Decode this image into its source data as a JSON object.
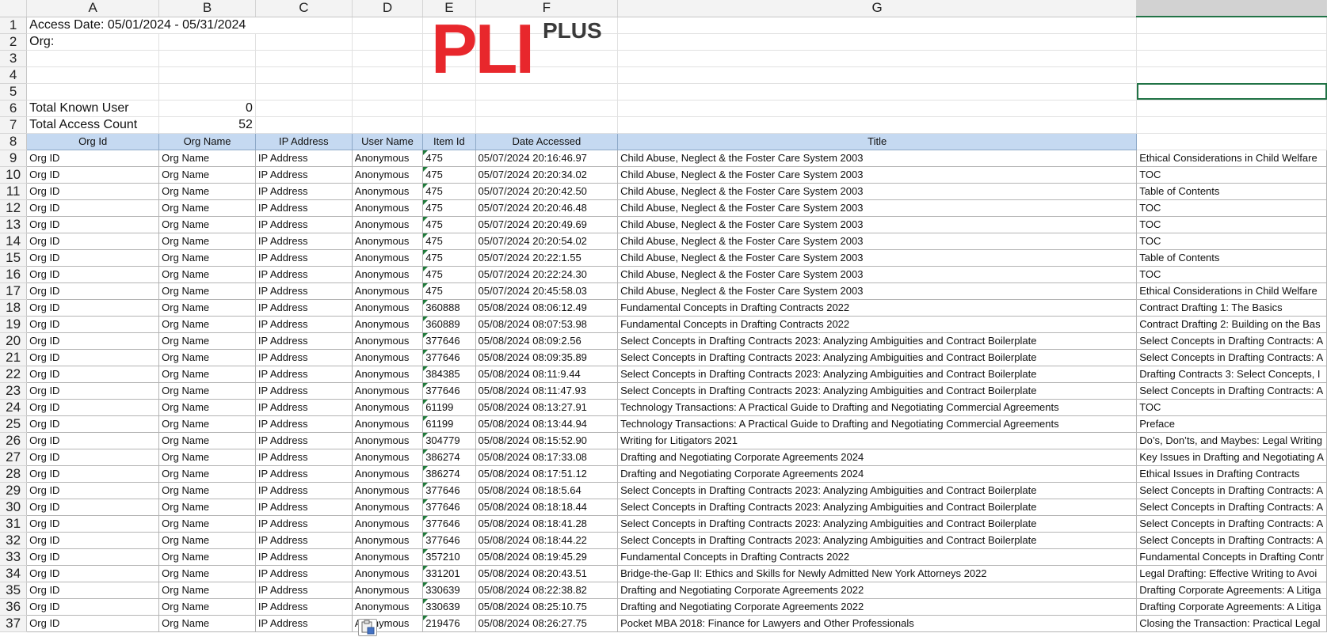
{
  "columns": [
    "A",
    "B",
    "C",
    "D",
    "E",
    "F",
    "G"
  ],
  "info": {
    "access_date": "Access Date:  05/01/2024 - 05/31/2024",
    "org": "Org:",
    "known_user_label": "Total Known User",
    "known_user_value": "0",
    "access_count_label": "Total Access Count",
    "access_count_value": "52"
  },
  "logo": {
    "main": "PLI",
    "sub": "PLUS",
    "color": "#e8272c"
  },
  "headers": [
    "Org Id",
    "Org Name",
    "IP Address",
    "User Name",
    "Item Id",
    "Date Accessed",
    "Title"
  ],
  "rows": [
    {
      "n": "9",
      "org_id": "Org ID",
      "org_name": "Org Name",
      "ip": "IP Address",
      "user": "Anonymous",
      "item": "475",
      "date": "05/07/2024 20:16:46.97",
      "title": "Child Abuse, Neglect & the Foster Care System 2003",
      "extra": "Ethical Considerations in Child Welfare"
    },
    {
      "n": "10",
      "org_id": "Org ID",
      "org_name": "Org Name",
      "ip": "IP Address",
      "user": "Anonymous",
      "item": "475",
      "date": "05/07/2024 20:20:34.02",
      "title": "Child Abuse, Neglect & the Foster Care System 2003",
      "extra": "TOC"
    },
    {
      "n": "11",
      "org_id": "Org ID",
      "org_name": "Org Name",
      "ip": "IP Address",
      "user": "Anonymous",
      "item": "475",
      "date": "05/07/2024 20:20:42.50",
      "title": "Child Abuse, Neglect & the Foster Care System 2003",
      "extra": "Table of Contents"
    },
    {
      "n": "12",
      "org_id": "Org ID",
      "org_name": "Org Name",
      "ip": "IP Address",
      "user": "Anonymous",
      "item": "475",
      "date": "05/07/2024 20:20:46.48",
      "title": "Child Abuse, Neglect & the Foster Care System 2003",
      "extra": "TOC"
    },
    {
      "n": "13",
      "org_id": "Org ID",
      "org_name": "Org Name",
      "ip": "IP Address",
      "user": "Anonymous",
      "item": "475",
      "date": "05/07/2024 20:20:49.69",
      "title": "Child Abuse, Neglect & the Foster Care System 2003",
      "extra": "TOC"
    },
    {
      "n": "14",
      "org_id": "Org ID",
      "org_name": "Org Name",
      "ip": "IP Address",
      "user": "Anonymous",
      "item": "475",
      "date": "05/07/2024 20:20:54.02",
      "title": "Child Abuse, Neglect & the Foster Care System 2003",
      "extra": "TOC"
    },
    {
      "n": "15",
      "org_id": "Org ID",
      "org_name": "Org Name",
      "ip": "IP Address",
      "user": "Anonymous",
      "item": "475",
      "date": "05/07/2024 20:22:1.55",
      "title": "Child Abuse, Neglect & the Foster Care System 2003",
      "extra": "Table of Contents"
    },
    {
      "n": "16",
      "org_id": "Org ID",
      "org_name": "Org Name",
      "ip": "IP Address",
      "user": "Anonymous",
      "item": "475",
      "date": "05/07/2024 20:22:24.30",
      "title": "Child Abuse, Neglect & the Foster Care System 2003",
      "extra": "TOC"
    },
    {
      "n": "17",
      "org_id": "Org ID",
      "org_name": "Org Name",
      "ip": "IP Address",
      "user": "Anonymous",
      "item": "475",
      "date": "05/07/2024 20:45:58.03",
      "title": "Child Abuse, Neglect & the Foster Care System 2003",
      "extra": "Ethical Considerations in Child Welfare"
    },
    {
      "n": "18",
      "org_id": "Org ID",
      "org_name": "Org Name",
      "ip": "IP Address",
      "user": "Anonymous",
      "item": "360888",
      "date": "05/08/2024 08:06:12.49",
      "title": "Fundamental Concepts in Drafting Contracts 2022",
      "extra": "Contract Drafting 1: The Basics"
    },
    {
      "n": "19",
      "org_id": "Org ID",
      "org_name": "Org Name",
      "ip": "IP Address",
      "user": "Anonymous",
      "item": "360889",
      "date": "05/08/2024 08:07:53.98",
      "title": "Fundamental Concepts in Drafting Contracts 2022",
      "extra": "Contract Drafting 2: Building on the Bas"
    },
    {
      "n": "20",
      "org_id": "Org ID",
      "org_name": "Org Name",
      "ip": "IP Address",
      "user": "Anonymous",
      "item": "377646",
      "date": "05/08/2024 08:09:2.56",
      "title": "Select Concepts in Drafting Contracts 2023: Analyzing Ambiguities and Contract Boilerplate",
      "extra": "Select Concepts in Drafting Contracts: A"
    },
    {
      "n": "21",
      "org_id": "Org ID",
      "org_name": "Org Name",
      "ip": "IP Address",
      "user": "Anonymous",
      "item": "377646",
      "date": "05/08/2024 08:09:35.89",
      "title": "Select Concepts in Drafting Contracts 2023: Analyzing Ambiguities and Contract Boilerplate",
      "extra": "Select Concepts in Drafting Contracts: A"
    },
    {
      "n": "22",
      "org_id": "Org ID",
      "org_name": "Org Name",
      "ip": "IP Address",
      "user": "Anonymous",
      "item": "384385",
      "date": "05/08/2024 08:11:9.44",
      "title": "Select Concepts in Drafting Contracts 2023: Analyzing Ambiguities and Contract Boilerplate",
      "extra": "Drafting Contracts 3: Select Concepts, I"
    },
    {
      "n": "23",
      "org_id": "Org ID",
      "org_name": "Org Name",
      "ip": "IP Address",
      "user": "Anonymous",
      "item": "377646",
      "date": "05/08/2024 08:11:47.93",
      "title": "Select Concepts in Drafting Contracts 2023: Analyzing Ambiguities and Contract Boilerplate",
      "extra": "Select Concepts in Drafting Contracts: A"
    },
    {
      "n": "24",
      "org_id": "Org ID",
      "org_name": "Org Name",
      "ip": "IP Address",
      "user": "Anonymous",
      "item": "61199",
      "date": "05/08/2024 08:13:27.91",
      "title": "Technology Transactions: A Practical Guide to Drafting and Negotiating Commercial Agreements",
      "extra": "TOC"
    },
    {
      "n": "25",
      "org_id": "Org ID",
      "org_name": "Org Name",
      "ip": "IP Address",
      "user": "Anonymous",
      "item": "61199",
      "date": "05/08/2024 08:13:44.94",
      "title": "Technology Transactions: A Practical Guide to Drafting and Negotiating Commercial Agreements",
      "extra": "Preface"
    },
    {
      "n": "26",
      "org_id": "Org ID",
      "org_name": "Org Name",
      "ip": "IP Address",
      "user": "Anonymous",
      "item": "304779",
      "date": "05/08/2024 08:15:52.90",
      "title": "Writing for Litigators 2021",
      "extra": "Do’s, Don’ts, and Maybes: Legal Writing"
    },
    {
      "n": "27",
      "org_id": "Org ID",
      "org_name": "Org Name",
      "ip": "IP Address",
      "user": "Anonymous",
      "item": "386274",
      "date": "05/08/2024 08:17:33.08",
      "title": "Drafting and Negotiating Corporate Agreements 2024",
      "extra": "Key Issues in Drafting and Negotiating A"
    },
    {
      "n": "28",
      "org_id": "Org ID",
      "org_name": "Org Name",
      "ip": "IP Address",
      "user": "Anonymous",
      "item": "386274",
      "date": "05/08/2024 08:17:51.12",
      "title": "Drafting and Negotiating Corporate Agreements 2024",
      "extra": "Ethical Issues in Drafting Contracts"
    },
    {
      "n": "29",
      "org_id": "Org ID",
      "org_name": "Org Name",
      "ip": "IP Address",
      "user": "Anonymous",
      "item": "377646",
      "date": "05/08/2024 08:18:5.64",
      "title": "Select Concepts in Drafting Contracts 2023: Analyzing Ambiguities and Contract Boilerplate",
      "extra": "Select Concepts in Drafting Contracts: A"
    },
    {
      "n": "30",
      "org_id": "Org ID",
      "org_name": "Org Name",
      "ip": "IP Address",
      "user": "Anonymous",
      "item": "377646",
      "date": "05/08/2024 08:18:18.44",
      "title": "Select Concepts in Drafting Contracts 2023: Analyzing Ambiguities and Contract Boilerplate",
      "extra": "Select Concepts in Drafting Contracts: A"
    },
    {
      "n": "31",
      "org_id": "Org ID",
      "org_name": "Org Name",
      "ip": "IP Address",
      "user": "Anonymous",
      "item": "377646",
      "date": "05/08/2024 08:18:41.28",
      "title": "Select Concepts in Drafting Contracts 2023: Analyzing Ambiguities and Contract Boilerplate",
      "extra": "Select Concepts in Drafting Contracts: A"
    },
    {
      "n": "32",
      "org_id": "Org ID",
      "org_name": "Org Name",
      "ip": "IP Address",
      "user": "Anonymous",
      "item": "377646",
      "date": "05/08/2024 08:18:44.22",
      "title": "Select Concepts in Drafting Contracts 2023: Analyzing Ambiguities and Contract Boilerplate",
      "extra": "Select Concepts in Drafting Contracts: A"
    },
    {
      "n": "33",
      "org_id": "Org ID",
      "org_name": "Org Name",
      "ip": "IP Address",
      "user": "Anonymous",
      "item": "357210",
      "date": "05/08/2024 08:19:45.29",
      "title": "Fundamental Concepts in Drafting Contracts 2022",
      "extra": "Fundamental Concepts in Drafting Contr"
    },
    {
      "n": "34",
      "org_id": "Org ID",
      "org_name": "Org Name",
      "ip": "IP Address",
      "user": "Anonymous",
      "item": "331201",
      "date": "05/08/2024 08:20:43.51",
      "title": "Bridge-the-Gap II: Ethics and Skills for Newly Admitted New York Attorneys 2022",
      "extra": "Legal Drafting: Effective Writing to Avoi"
    },
    {
      "n": "35",
      "org_id": "Org ID",
      "org_name": "Org Name",
      "ip": "IP Address",
      "user": "Anonymous",
      "item": "330639",
      "date": "05/08/2024 08:22:38.82",
      "title": "Drafting and Negotiating Corporate Agreements 2022",
      "extra": "Drafting Corporate Agreements: A Litiga"
    },
    {
      "n": "36",
      "org_id": "Org ID",
      "org_name": "Org Name",
      "ip": "IP Address",
      "user": "Anonymous",
      "item": "330639",
      "date": "05/08/2024 08:25:10.75",
      "title": "Drafting and Negotiating Corporate Agreements 2022",
      "extra": "Drafting Corporate Agreements: A Litiga"
    },
    {
      "n": "37",
      "org_id": "Org ID",
      "org_name": "Org Name",
      "ip": "IP Address",
      "user": "Anonymous",
      "item": "219476",
      "date": "05/08/2024 08:26:27.75",
      "title": "Pocket MBA 2018: Finance for Lawyers and Other Professionals",
      "extra": "Closing the Transaction: Practical Legal"
    }
  ]
}
